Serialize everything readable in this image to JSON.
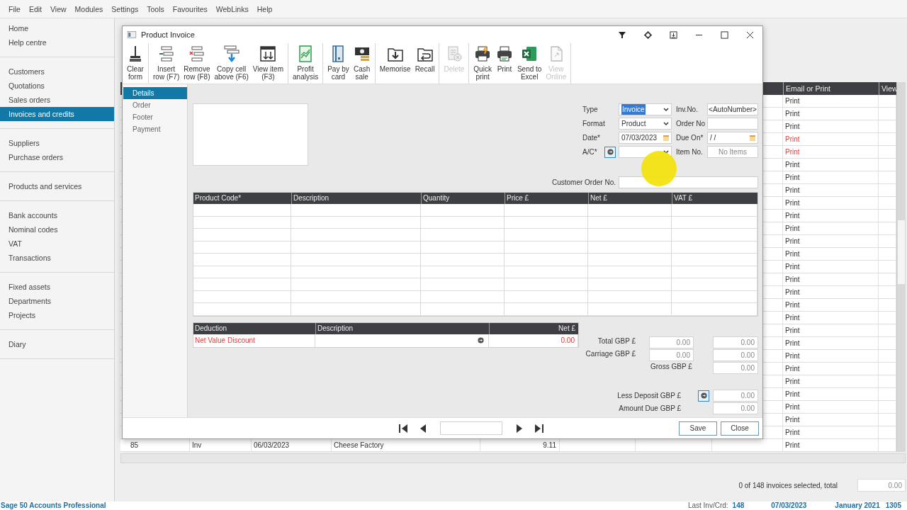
{
  "menu": [
    "File",
    "Edit",
    "View",
    "Modules",
    "Settings",
    "Tools",
    "Favourites",
    "WebLinks",
    "Help"
  ],
  "sidebar": {
    "groups": [
      [
        {
          "label": "Home",
          "selected": false
        },
        {
          "label": "Help centre",
          "selected": false
        }
      ],
      [
        {
          "label": "Customers",
          "selected": false
        },
        {
          "label": "Quotations",
          "selected": false
        },
        {
          "label": "Sales orders",
          "selected": false
        },
        {
          "label": "Invoices and credits",
          "selected": true
        }
      ],
      [
        {
          "label": "Suppliers",
          "selected": false
        },
        {
          "label": "Purchase orders",
          "selected": false
        }
      ],
      [
        {
          "label": "Products and services",
          "selected": false
        }
      ],
      [
        {
          "label": "Bank accounts",
          "selected": false
        },
        {
          "label": "Nominal codes",
          "selected": false
        },
        {
          "label": "VAT",
          "selected": false
        },
        {
          "label": "Transactions",
          "selected": false
        }
      ],
      [
        {
          "label": "Fixed assets",
          "selected": false
        },
        {
          "label": "Departments",
          "selected": false
        },
        {
          "label": "Projects",
          "selected": false
        }
      ],
      [
        {
          "label": "Diary",
          "selected": false
        }
      ]
    ]
  },
  "invoice_list": {
    "headers": {
      "email_or_print": "Email or Print",
      "view": "View"
    },
    "rows": [
      {
        "print": "Print",
        "flagged": false
      },
      {
        "print": "Print",
        "flagged": false
      },
      {
        "print": "Print",
        "flagged": false
      },
      {
        "print": "Print",
        "flagged": true
      },
      {
        "print": "Print",
        "flagged": true
      },
      {
        "print": "Print",
        "flagged": false
      },
      {
        "print": "Print",
        "flagged": false
      },
      {
        "print": "Print",
        "flagged": false
      },
      {
        "print": "Print",
        "flagged": false
      },
      {
        "print": "Print",
        "flagged": false
      },
      {
        "print": "Print",
        "flagged": false
      },
      {
        "print": "Print",
        "flagged": false
      },
      {
        "print": "Print",
        "flagged": false
      },
      {
        "print": "Print",
        "flagged": false
      },
      {
        "print": "Print",
        "flagged": false
      },
      {
        "print": "Print",
        "flagged": false
      },
      {
        "print": "Print",
        "flagged": false
      },
      {
        "print": "Print",
        "flagged": false
      },
      {
        "print": "Print",
        "flagged": false
      },
      {
        "print": "Print",
        "flagged": false
      },
      {
        "print": "Print",
        "flagged": false
      },
      {
        "print": "Print",
        "flagged": false
      },
      {
        "print": "Print",
        "flagged": false
      },
      {
        "print": "Print",
        "flagged": false
      },
      {
        "print": "Print",
        "flagged": false
      },
      {
        "print": "Print",
        "flagged": false
      },
      {
        "print": "Print",
        "flagged": false
      },
      {
        "no": "85",
        "type": "Inv",
        "date": "06/03/2023",
        "name": "Cheese Factory",
        "amount": "9.11",
        "print": "Print",
        "flagged": false
      }
    ],
    "selection": "0 of 148 invoices selected, total",
    "total": "0.00"
  },
  "status_bar": {
    "product": "Sage 50 Accounts Professional",
    "last_label": "Last Inv/Crd:",
    "last_value": "148",
    "date": "07/03/2023",
    "period": "January 2021",
    "code": "1305"
  },
  "dialog": {
    "title": "Product Invoice",
    "toolbar": [
      [
        {
          "lines": [
            "Clear",
            "form"
          ],
          "disabled": false
        }
      ],
      [
        {
          "lines": [
            "Insert",
            "row (F7)"
          ],
          "disabled": false
        },
        {
          "lines": [
            "Remove",
            "row (F8)"
          ],
          "disabled": false
        },
        {
          "lines": [
            "Copy cell",
            "above (F6)"
          ],
          "disabled": false
        },
        {
          "lines": [
            "View item",
            "(F3)"
          ],
          "disabled": false
        }
      ],
      [
        {
          "lines": [
            "Profit",
            "analysis"
          ],
          "disabled": false
        }
      ],
      [
        {
          "lines": [
            "Pay by",
            "card"
          ],
          "disabled": false
        },
        {
          "lines": [
            "Cash",
            "sale"
          ],
          "disabled": false
        }
      ],
      [
        {
          "lines": [
            "Memorise"
          ],
          "disabled": false
        },
        {
          "lines": [
            "Recall"
          ],
          "disabled": false
        }
      ],
      [
        {
          "lines": [
            "Delete"
          ],
          "disabled": true
        }
      ],
      [
        {
          "lines": [
            "Quick",
            "print"
          ],
          "disabled": false
        },
        {
          "lines": [
            "Print"
          ],
          "disabled": false
        },
        {
          "lines": [
            "Send to",
            "Excel"
          ],
          "disabled": false
        },
        {
          "lines": [
            "View",
            "Online"
          ],
          "disabled": true
        }
      ]
    ],
    "nav": [
      {
        "label": "Details",
        "selected": true
      },
      {
        "label": "Order",
        "selected": false
      },
      {
        "label": "Footer",
        "selected": false
      },
      {
        "label": "Payment",
        "selected": false
      }
    ],
    "fields": {
      "type": {
        "label": "Type",
        "value": "Invoice",
        "highlighted": true
      },
      "inv_no": {
        "label": "Inv.No.",
        "value": "<AutoNumber>"
      },
      "format": {
        "label": "Format",
        "value": "Product"
      },
      "order_no": {
        "label": "Order No"
      },
      "date": {
        "label": "Date*",
        "value": "07/03/2023"
      },
      "due_on": {
        "label": "Due On*",
        "value": "/ /"
      },
      "account": {
        "label": "A/C*"
      },
      "item_no": {
        "label": "Item No.",
        "value": "No Items"
      },
      "customer_order_no": {
        "label": "Customer Order No."
      }
    },
    "items_table": {
      "columns": [
        "Product Code*",
        "Description",
        "Quantity",
        "Price £",
        "Net £",
        "VAT £"
      ]
    },
    "deductions": {
      "columns": [
        "Deduction",
        "Description",
        "Net £"
      ],
      "rows": [
        {
          "deduction": "Net Value Discount",
          "net": "0.00"
        }
      ]
    },
    "totals": [
      {
        "kind": "pair",
        "label": "Total GBP £",
        "values": [
          "0.00",
          "0.00"
        ]
      },
      {
        "kind": "pair",
        "label": "Carriage GBP £",
        "values": [
          "0.00",
          "0.00"
        ]
      },
      {
        "kind": "single",
        "label": "Gross GBP £",
        "value": "0.00"
      },
      {
        "kind": "deposit",
        "label": "Less Deposit GBP £",
        "value": "0.00"
      },
      {
        "kind": "due",
        "label": "Amount Due GBP £",
        "value": "0.00"
      }
    ],
    "buttons": [
      "Save",
      "Close"
    ]
  }
}
